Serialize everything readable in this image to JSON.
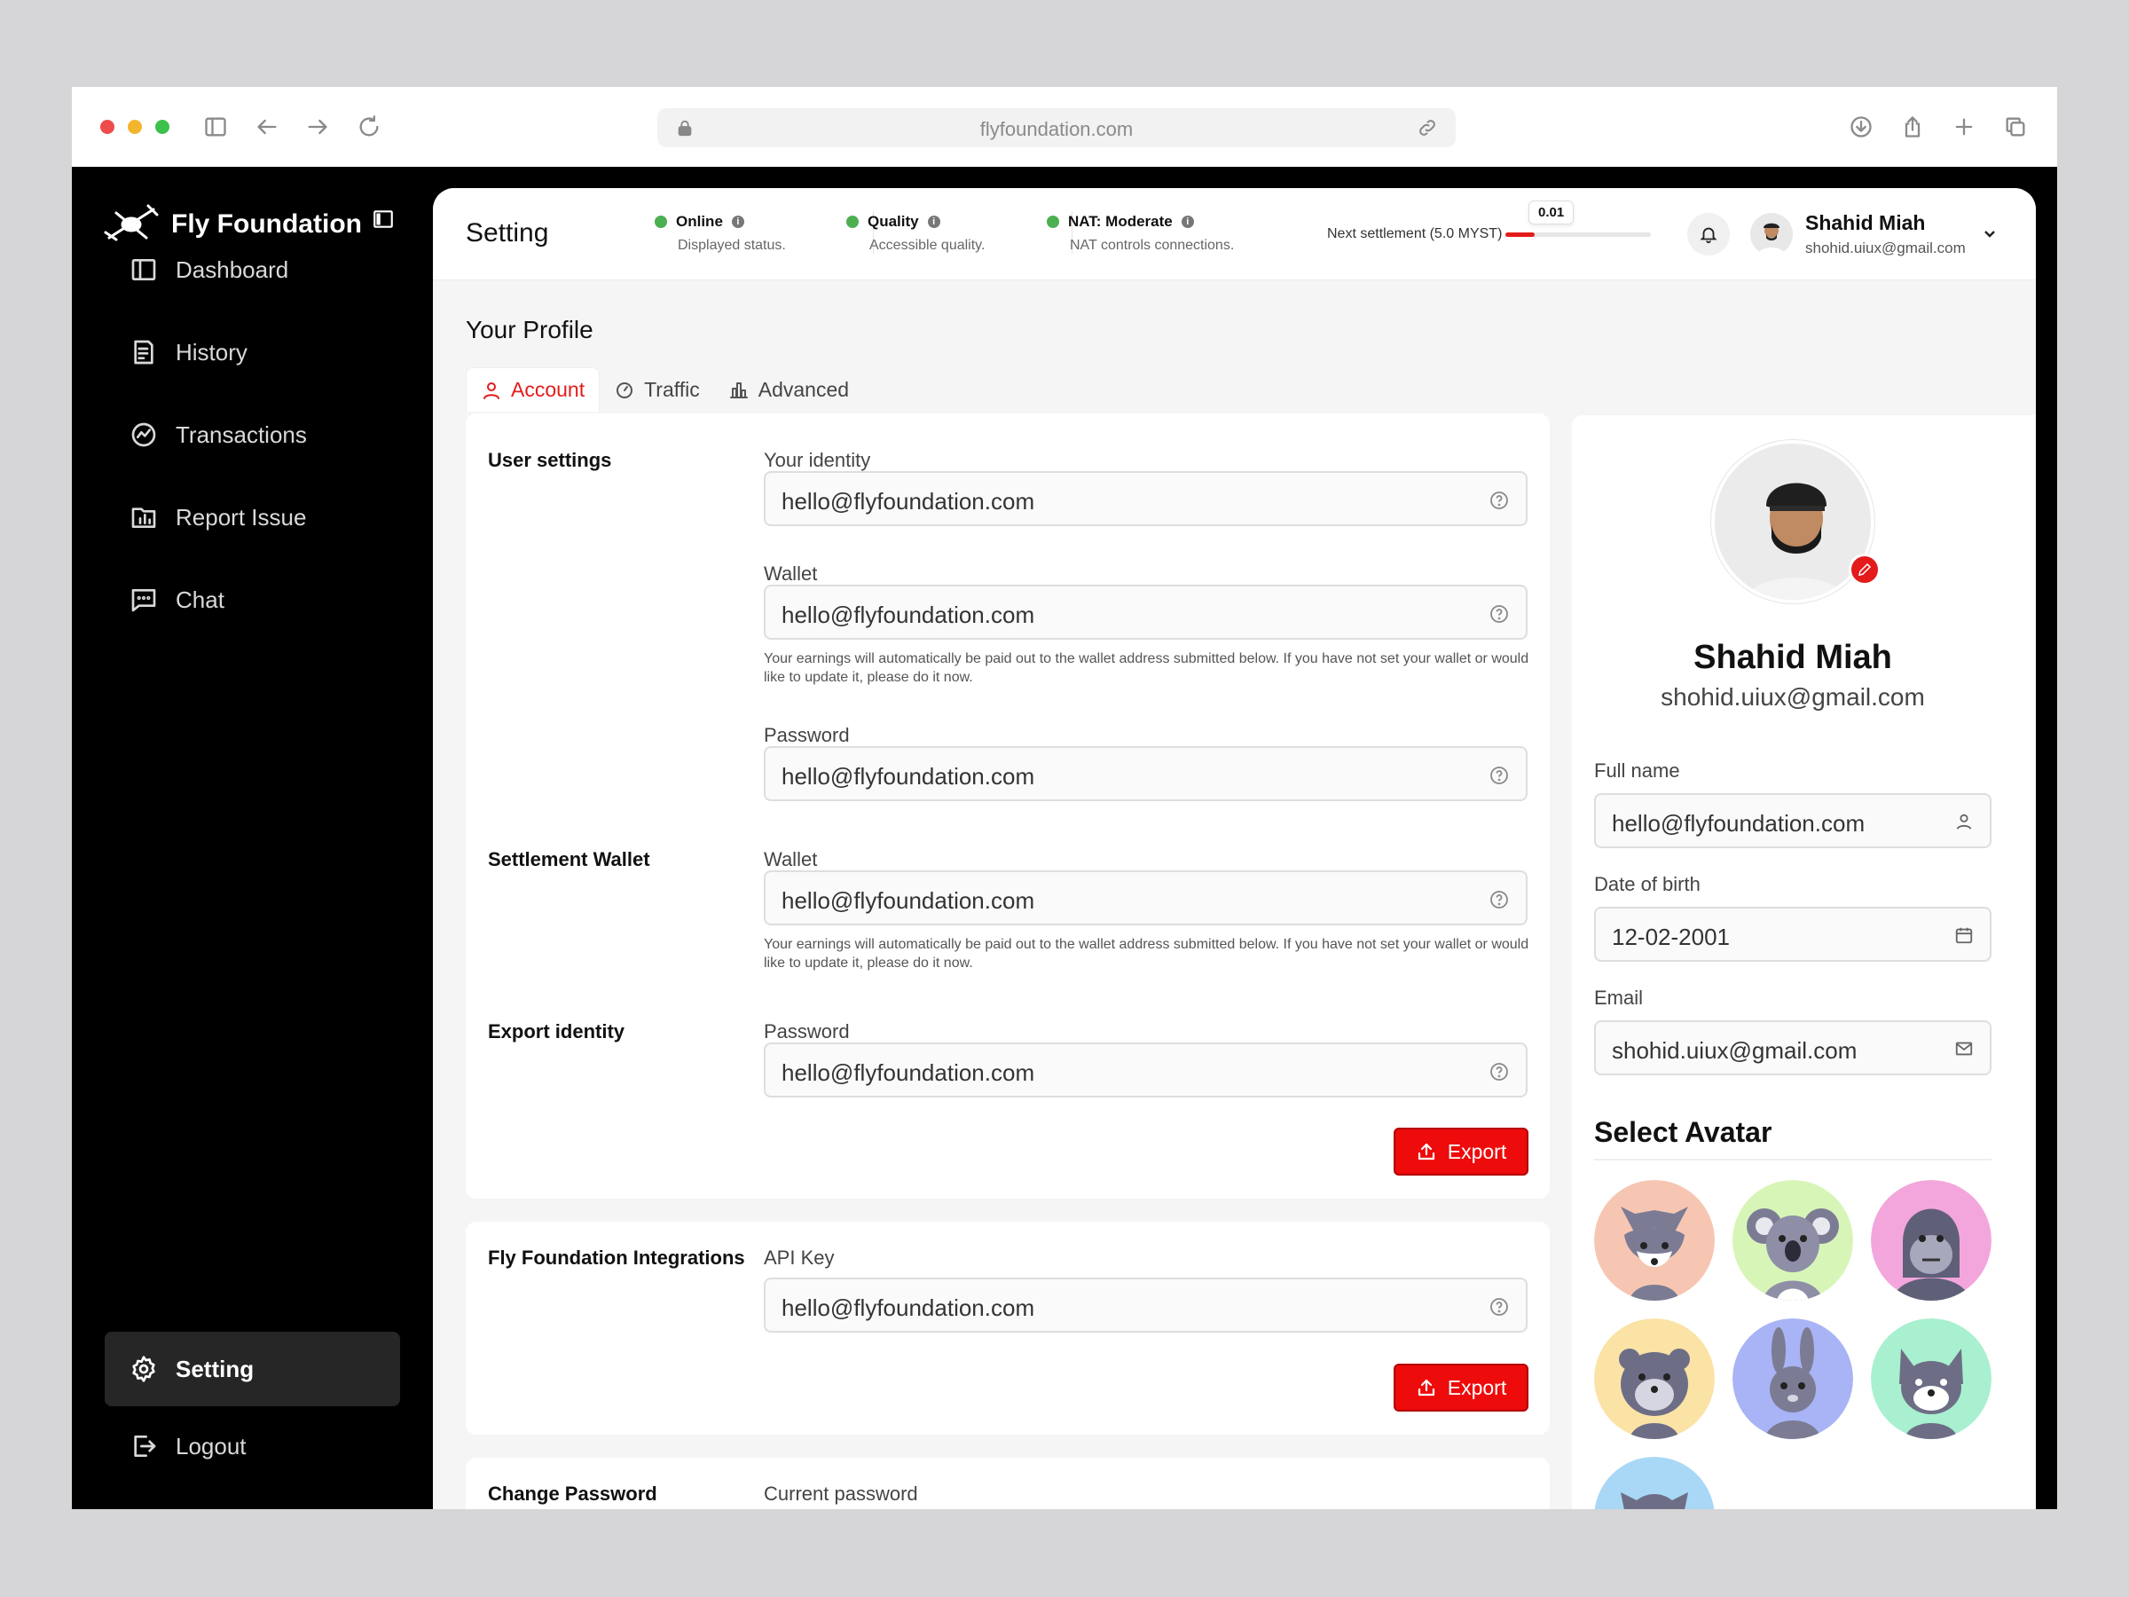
{
  "browser": {
    "url": "flyfoundation.com"
  },
  "sidebar": {
    "brand": "Fly Foundation",
    "items": [
      {
        "label": "Dashboard",
        "icon": "layout-icon"
      },
      {
        "label": "History",
        "icon": "document-icon"
      },
      {
        "label": "Transactions",
        "icon": "chart-circle-icon"
      },
      {
        "label": "Report Issue",
        "icon": "report-icon"
      },
      {
        "label": "Chat",
        "icon": "chat-icon"
      }
    ],
    "bottom_items": [
      {
        "label": "Setting",
        "icon": "gear-icon",
        "active": true
      },
      {
        "label": "Logout",
        "icon": "logout-icon"
      }
    ]
  },
  "topbar": {
    "title": "Setting",
    "statuses": [
      {
        "title": "Online",
        "subtitle": "Displayed status."
      },
      {
        "title": "Quality",
        "subtitle": "Accessible quality."
      },
      {
        "title": "NAT: Moderate",
        "subtitle": "NAT controls connections."
      }
    ],
    "settlement_label": "Next settlement (5.0 MYST)",
    "settlement_value": "0.01",
    "settlement_progress": 0.2,
    "user_name": "Shahid Miah",
    "user_email": "shohid.uiux@gmail.com"
  },
  "profile": {
    "title": "Your Profile",
    "tabs": [
      "Account",
      "Traffic",
      "Advanced"
    ],
    "user_settings": {
      "label": "User settings",
      "identity_label": "Your identity",
      "identity_value": "hello@flyfoundation.com",
      "wallet_label": "Wallet",
      "wallet_value": "hello@flyfoundation.com",
      "wallet_hint": "Your earnings will automatically be paid out to the wallet address submitted below. If you have not set your wallet or would like to update it, please do it now.",
      "password_label": "Password",
      "password_value": "hello@flyfoundation.com"
    },
    "settlement_wallet": {
      "label": "Settlement Wallet",
      "wallet_label": "Wallet",
      "wallet_value": "hello@flyfoundation.com",
      "wallet_hint": "Your earnings will automatically be paid out to the wallet address submitted below. If you have not set your wallet or would like to update it, please do it now."
    },
    "export_identity": {
      "label": "Export identity",
      "password_label": "Password",
      "password_value": "hello@flyfoundation.com",
      "button": "Export"
    },
    "integrations": {
      "label": "Fly Foundation Integrations",
      "api_label": "API Key",
      "api_value": "hello@flyfoundation.com",
      "button": "Export"
    },
    "change_password": {
      "label": "Change Password",
      "current_label": "Current password"
    }
  },
  "right_panel": {
    "name": "Shahid Miah",
    "email": "shohid.uiux@gmail.com",
    "full_name_label": "Full name",
    "full_name_value": "hello@flyfoundation.com",
    "dob_label": "Date of birth",
    "dob_value": "12-02-2001",
    "email_label": "Email",
    "email_value": "shohid.uiux@gmail.com",
    "avatar_title": "Select Avatar",
    "avatars": [
      {
        "name": "fox-avatar",
        "bg": "#f7c6b2"
      },
      {
        "name": "koala-avatar",
        "bg": "#d8f5b8"
      },
      {
        "name": "gorilla-avatar",
        "bg": "#f3a6dc"
      },
      {
        "name": "hamster-avatar",
        "bg": "#fbe3a6"
      },
      {
        "name": "rabbit-avatar",
        "bg": "#a8b4f5"
      },
      {
        "name": "cat-avatar",
        "bg": "#a8f0cf"
      },
      {
        "name": "dog-avatar",
        "bg": "#a8d8f5"
      }
    ]
  },
  "colors": {
    "accent": "#e31b1b",
    "status_green": "#4caf50",
    "sidebar_bg": "#000000"
  }
}
